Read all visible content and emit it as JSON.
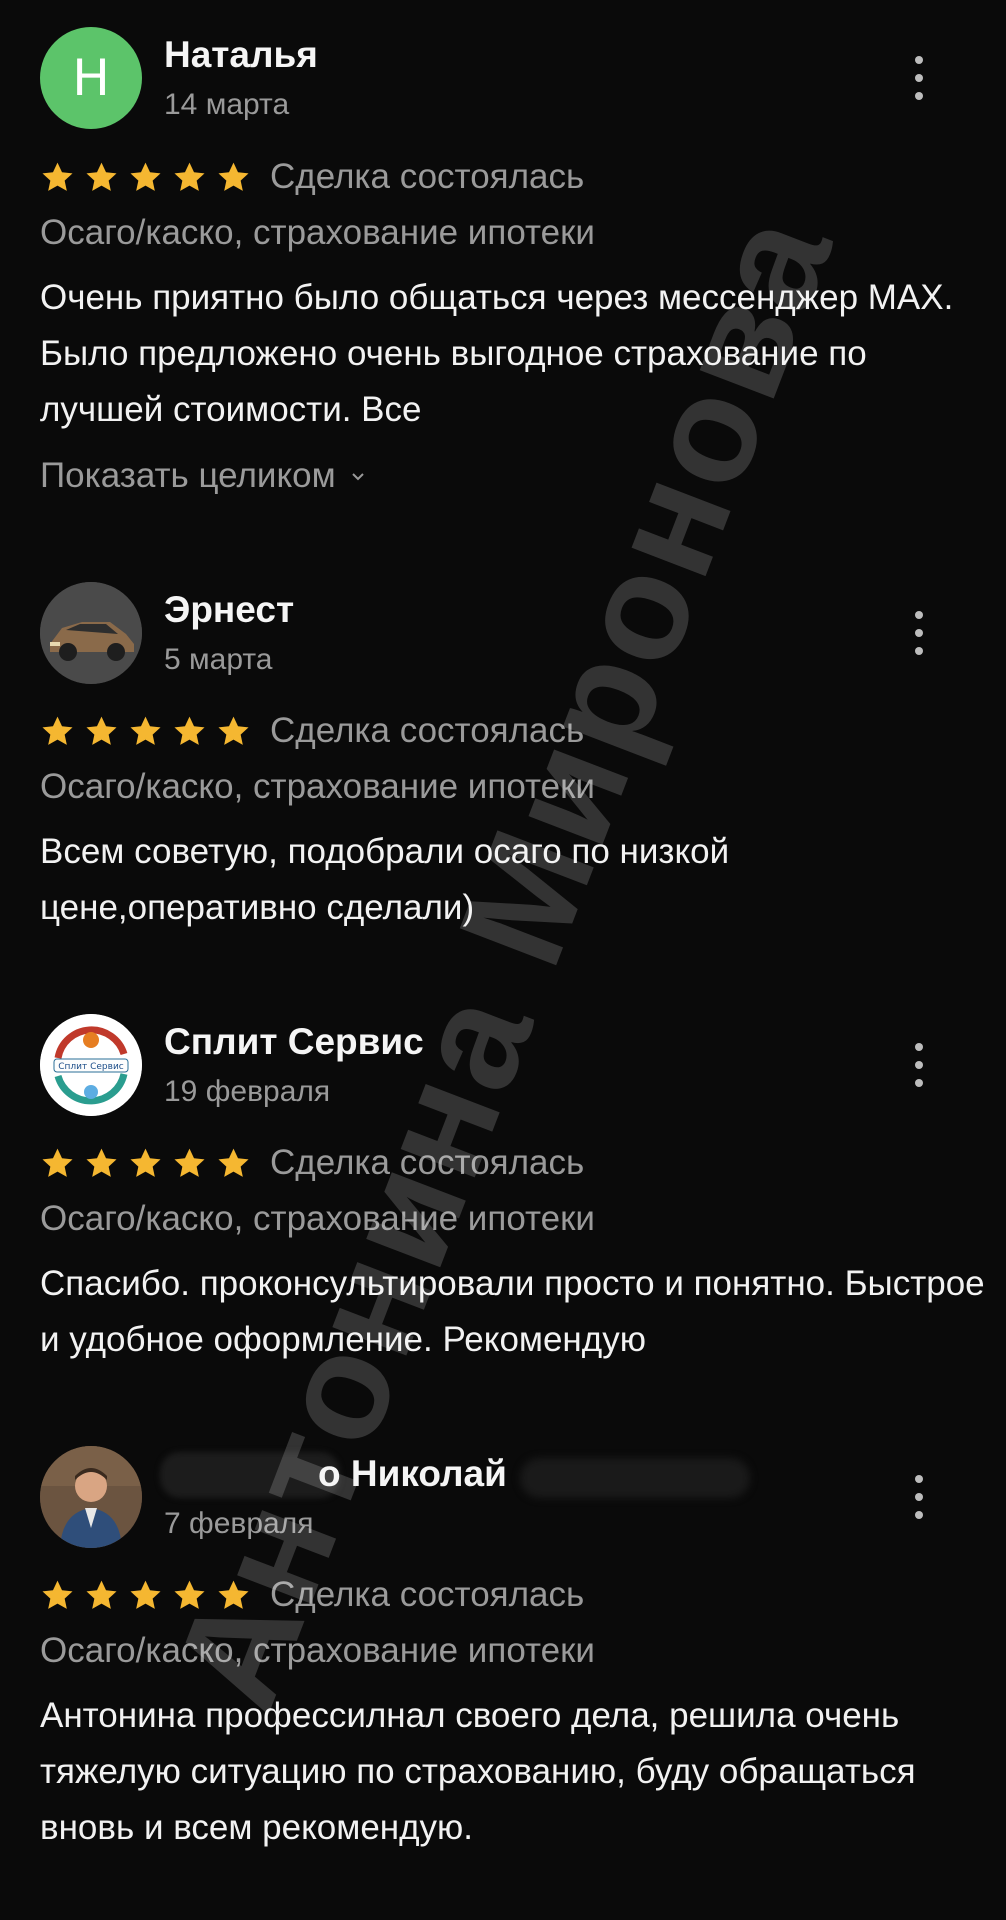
{
  "reviews": [
    {
      "name": "Наталья",
      "avatar_letter": "Н",
      "date": "14 марта",
      "rating": 5,
      "deal_status": "Сделка состоялась",
      "category": "Осаго/каско, страхование ипотеки",
      "text": "Очень приятно было общаться через мессенджер MAX. Было предложено очень выгодное страхование по лучшей стоимости. Все",
      "show_more": "Показать целиком"
    },
    {
      "name": "Эрнест",
      "date": "5 марта",
      "rating": 5,
      "deal_status": "Сделка состоялась",
      "category": "Осаго/каско, страхование ипотеки",
      "text": "Всем советую, подобрали осаго по низкой цене,оперативно сделали)"
    },
    {
      "name": "Сплит Сервис",
      "avatar_label": "Сплит Сервис",
      "date": "19 февраля",
      "rating": 5,
      "deal_status": "Сделка состоялась",
      "category": "Осаго/каско, страхование ипотеки",
      "text": "Спасибо. проконсультировали просто и понятно. Быстрое и удобное  оформление. Рекомендую"
    },
    {
      "name": "о Николай",
      "date": "7 февраля",
      "rating": 5,
      "deal_status": "Сделка состоялась",
      "category": "Осаго/каско, страхование ипотеки",
      "text": "Антонина профессилнал своего дела, решила очень тяжелую ситуацию по страхованию, буду обращаться вновь и всем рекомендую."
    }
  ],
  "watermark": "Антонина Миронова",
  "colors": {
    "background": "#0a0a0a",
    "star": "#f5b731",
    "avatar_green": "#5cc46a",
    "muted_text": "#9a9a9a"
  },
  "icons": [
    "more-vertical-icon",
    "star-icon",
    "chevron-down-icon"
  ]
}
